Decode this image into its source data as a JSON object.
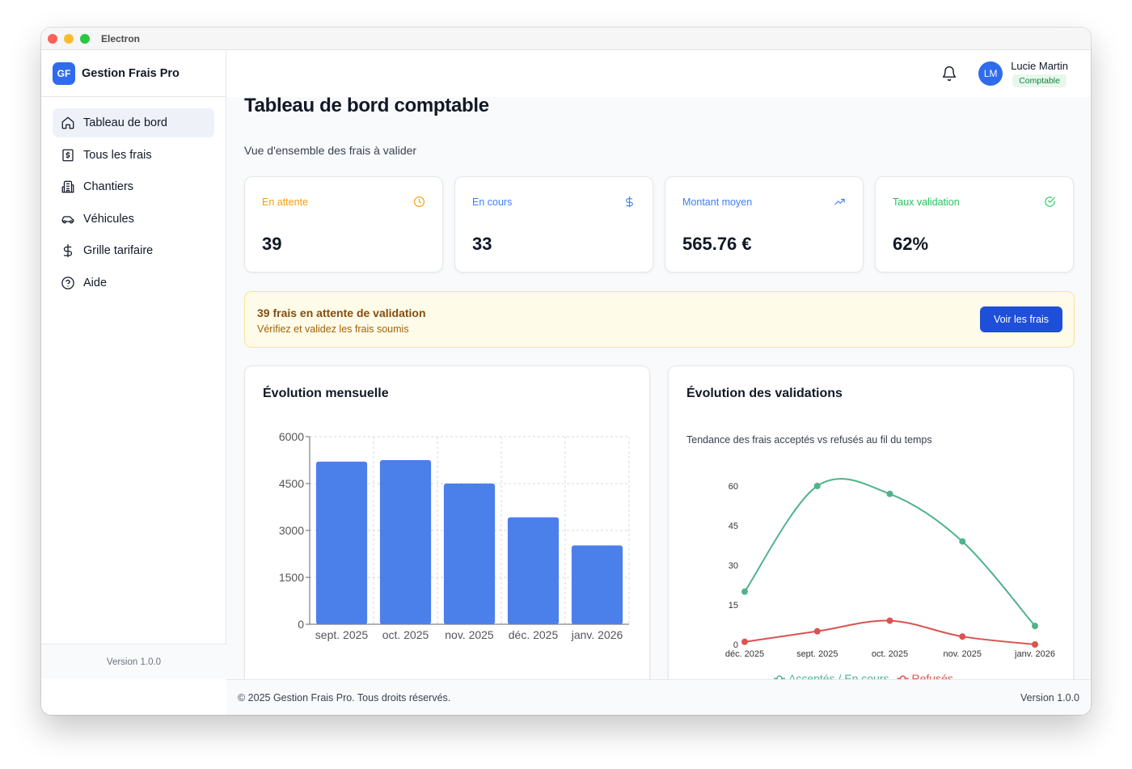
{
  "window": {
    "title": "Electron"
  },
  "brand": {
    "logo": "GF",
    "name": "Gestion Frais Pro"
  },
  "sidebar": {
    "items": [
      {
        "label": "Tableau de bord",
        "icon": "home-icon",
        "active": true
      },
      {
        "label": "Tous les frais",
        "icon": "receipt-dollar-icon"
      },
      {
        "label": "Chantiers",
        "icon": "building-icon"
      },
      {
        "label": "Véhicules",
        "icon": "car-icon"
      },
      {
        "label": "Grille tarifaire",
        "icon": "dollar-icon"
      },
      {
        "label": "Aide",
        "icon": "help-circle-icon"
      }
    ],
    "version": "Version 1.0.0"
  },
  "header": {
    "user_initials": "LM",
    "user_name": "Lucie Martin",
    "user_role": "Comptable"
  },
  "page": {
    "title": "Tableau de bord comptable",
    "subtitle": "Vue d'ensemble des frais à valider"
  },
  "stats": [
    {
      "label": "En attente",
      "value": "39",
      "icon": "clock-icon",
      "color": "#f59e0b"
    },
    {
      "label": "En cours",
      "value": "33",
      "icon": "dollar-icon",
      "color": "#3b82f6"
    },
    {
      "label": "Montant moyen",
      "value": "565.76 €",
      "icon": "trending-up-icon",
      "color": "#3b82f6"
    },
    {
      "label": "Taux validation",
      "value": "62%",
      "icon": "check-circle-icon",
      "color": "#22c55e"
    }
  ],
  "alert": {
    "title": "39 frais en attente de validation",
    "subtitle": "Vérifiez et validez les frais soumis",
    "button": "Voir les frais"
  },
  "monthly_chart": {
    "title": "Évolution mensuelle"
  },
  "validation_chart": {
    "title": "Évolution des validations",
    "description": "Tendance des frais acceptés vs refusés au fil du temps"
  },
  "footer": {
    "copyright": "© 2025 Gestion Frais Pro. Tous droits réservés.",
    "version": "Version 1.0.0"
  },
  "chart_data": [
    {
      "type": "bar",
      "categories": [
        "sept. 2025",
        "oct. 2025",
        "nov. 2025",
        "déc. 2025",
        "janv. 2026"
      ],
      "values": [
        5200,
        5250,
        4500,
        3420,
        2520
      ],
      "title": "Évolution mensuelle",
      "ylim": [
        0,
        6000
      ],
      "yticks": [
        0,
        1500,
        3000,
        4500,
        6000
      ],
      "grid": true,
      "color": "#4b80ea"
    },
    {
      "type": "line",
      "categories": [
        "déc. 2025",
        "sept. 2025",
        "oct. 2025",
        "nov. 2025",
        "janv. 2026"
      ],
      "series": [
        {
          "name": "Acceptés / En cours",
          "values": [
            20,
            60,
            57,
            39,
            7
          ],
          "color": "#4fb38a"
        },
        {
          "name": "Refusés",
          "values": [
            1,
            5,
            9,
            3,
            0
          ],
          "color": "#d9534f"
        }
      ],
      "ylim": [
        0,
        60
      ],
      "yticks": [
        0,
        15,
        30,
        45,
        60
      ],
      "grid": false,
      "legend": "bottom"
    }
  ]
}
